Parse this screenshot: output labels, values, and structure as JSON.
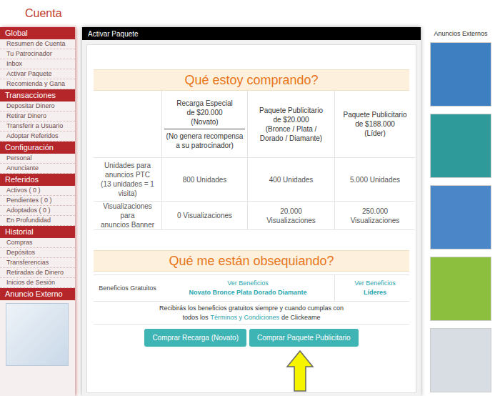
{
  "page_title": "Cuenta",
  "sidebar": {
    "sections": [
      {
        "title": "Global",
        "items": [
          "Resumen de Cuenta",
          "Tu Patrocinador",
          "Inbox",
          "Activar Paquete",
          "Recomienda y Gana"
        ]
      },
      {
        "title": "Transacciones",
        "items": [
          "Depositar Dinero",
          "Retirar Dinero",
          "Transferir a Usuario",
          "Adoptar Referidos"
        ]
      },
      {
        "title": "Configuración",
        "items": [
          "Personal",
          "Anunciante"
        ]
      },
      {
        "title": "Referidos",
        "items": [
          "Activos ( 0 )",
          "Pendientes ( 0 )",
          "Adoptados ( 0 )",
          "En Profundidad"
        ]
      },
      {
        "title": "Historial",
        "items": [
          "Compras",
          "Depósitos",
          "Transferencias",
          "Retiradas de Dinero",
          "Inicios de Sesión"
        ]
      }
    ],
    "external_ad": {
      "title": "Anuncio Externo"
    }
  },
  "ads_column": {
    "title": "Anuncios Externos",
    "ads": [
      {
        "color": "#3d7fc0"
      },
      {
        "color": "#2f9a9a"
      },
      {
        "color": "#4a86c8"
      },
      {
        "color": "#8dbf3f"
      },
      {
        "color": "#d8dde3"
      }
    ]
  },
  "modal": {
    "title": "Activar Paquete",
    "purchase": {
      "heading": "Qué estoy comprando?",
      "columns": [
        {
          "lines": [
            "Recarga Especial",
            "de $20.000",
            "(Novato)"
          ],
          "note": [
            "(No genera recompensa",
            "a su patrocinador)"
          ]
        },
        {
          "lines": [
            "Paquete Publicitario",
            "de $20.000",
            "(Bronce / Plata /",
            "Dorado / Diamante)"
          ]
        },
        {
          "lines": [
            "Paquete Publicitario",
            "de $188.000",
            "(Líder)"
          ]
        }
      ],
      "rows": [
        {
          "label": [
            "Unidades para",
            "anuncios PTC",
            "(13 unidades = 1",
            "visita)"
          ],
          "cells": [
            [
              "800 Unidades"
            ],
            [
              "400 Unidades"
            ],
            [
              "5.000 Unidades"
            ]
          ]
        },
        {
          "label": [
            "Visualizaciones para",
            "anuncios Banner"
          ],
          "cells": [
            [
              "0 Visualizaciones"
            ],
            [
              "20.000",
              "Visualizaciones"
            ],
            [
              "250.000",
              "Visualizaciones"
            ]
          ]
        }
      ]
    },
    "gifts": {
      "heading": "Qué me están obsequiando?",
      "label": "Beneficios Gratuitos",
      "benefits": [
        {
          "link": "Ver Beneficios",
          "tiers": "Novato Bronce Plata Dorado Diamante"
        },
        {
          "link": "Ver Beneficios",
          "tiers": "Líderes"
        }
      ]
    },
    "note": {
      "line1": "Recibirás los beneficios gratuitos siempre y cuando cumplas con",
      "before": "todos los",
      "link": "Términos y Condiciones",
      "after": "de Clickeame"
    },
    "buttons": [
      "Comprar Recarga (Novato)",
      "Comprar Paquete Publicitario"
    ]
  }
}
